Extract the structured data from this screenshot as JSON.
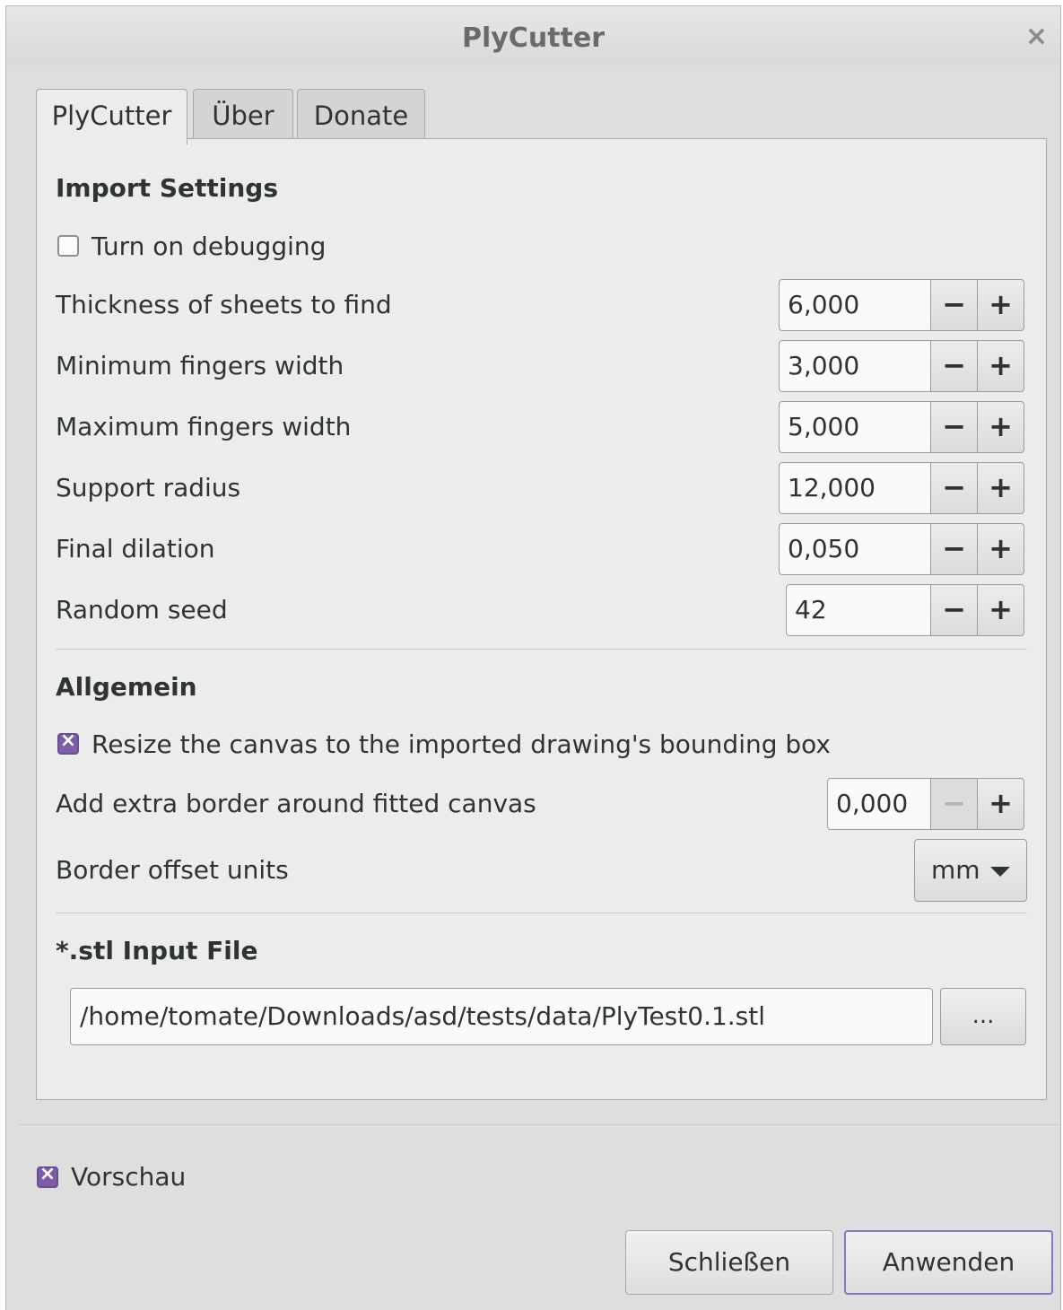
{
  "window": {
    "title": "PlyCutter",
    "close_glyph": "×"
  },
  "tabs": [
    {
      "label": "PlyCutter",
      "active": true
    },
    {
      "label": "Über",
      "active": false
    },
    {
      "label": "Donate",
      "active": false
    }
  ],
  "import_settings": {
    "heading": "Import Settings",
    "debugging": {
      "label": "Turn on debugging",
      "checked": false
    },
    "fields": [
      {
        "label": "Thickness of sheets to find",
        "value": "6,000"
      },
      {
        "label": "Minimum fingers width",
        "value": "3,000"
      },
      {
        "label": "Maximum fingers width",
        "value": "5,000"
      },
      {
        "label": "Support radius",
        "value": "12,000"
      },
      {
        "label": "Final dilation",
        "value": "0,050"
      },
      {
        "label": "Random seed",
        "value": "42"
      }
    ]
  },
  "general": {
    "heading": "Allgemein",
    "resize": {
      "label": "Resize the canvas to the imported drawing's bounding box",
      "checked": true
    },
    "extra_border": {
      "label": "Add extra border around fitted canvas",
      "value": "0,000"
    },
    "units": {
      "label": "Border offset units",
      "value": "mm"
    }
  },
  "input_file": {
    "heading": "*.stl Input File",
    "path": "/home/tomate/Downloads/asd/tests/data/PlyTest0.1.stl",
    "browse_label": "..."
  },
  "spin": {
    "minus": "−",
    "plus": "+"
  },
  "preview": {
    "label": "Vorschau",
    "checked": true
  },
  "buttons": {
    "close": "Schließen",
    "apply": "Anwenden"
  },
  "colors": {
    "accent": "#7c5ea6",
    "default_button_border": "#8e74bd"
  }
}
